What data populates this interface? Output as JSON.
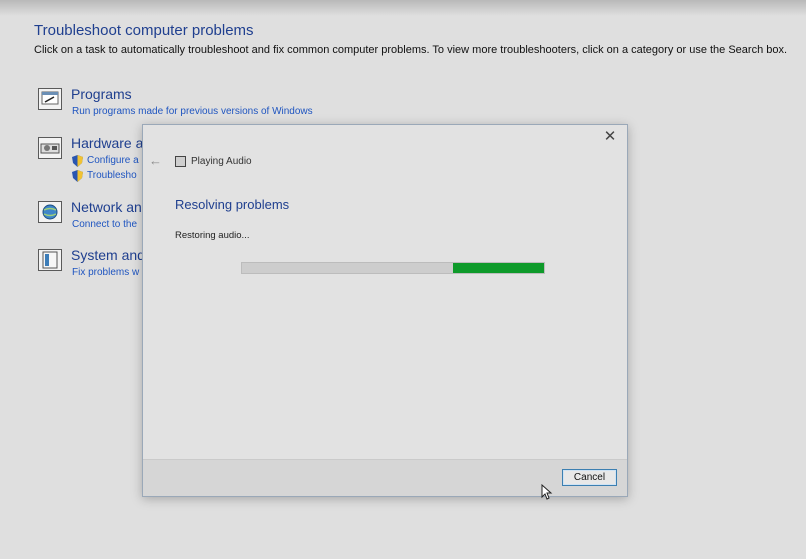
{
  "header": {
    "title": "Troubleshoot computer problems",
    "description": "Click on a task to automatically troubleshoot and fix common computer problems. To view more troubleshooters, click on a category or use the Search box."
  },
  "categories": [
    {
      "title": "Programs",
      "links": [
        "Run programs made for previous versions of Windows"
      ]
    },
    {
      "title": "Hardware a",
      "links": [
        "Configure a",
        "Troublesho"
      ]
    },
    {
      "title": "Network an",
      "links": [
        "Connect to the"
      ]
    },
    {
      "title": "System and",
      "links": [
        "Fix problems w"
      ]
    }
  ],
  "dialog": {
    "close_label": "✕",
    "back_label": "←",
    "app_title": "Playing Audio",
    "heading": "Resolving problems",
    "status": "Restoring audio...",
    "progress": {
      "indeterminate_segment_start": 0.7,
      "indeterminate_segment_end": 1.0
    },
    "cancel_label": "Cancel"
  },
  "colors": {
    "accent_title": "#1f3f8f",
    "link": "#1f55c0",
    "progress_green": "#0e9a2a"
  },
  "icons": [
    "programs-icon",
    "hardware-icon",
    "network-icon",
    "system-icon",
    "shield-icon",
    "back-arrow-icon",
    "close-icon",
    "audio-app-icon",
    "mouse-cursor-icon"
  ]
}
